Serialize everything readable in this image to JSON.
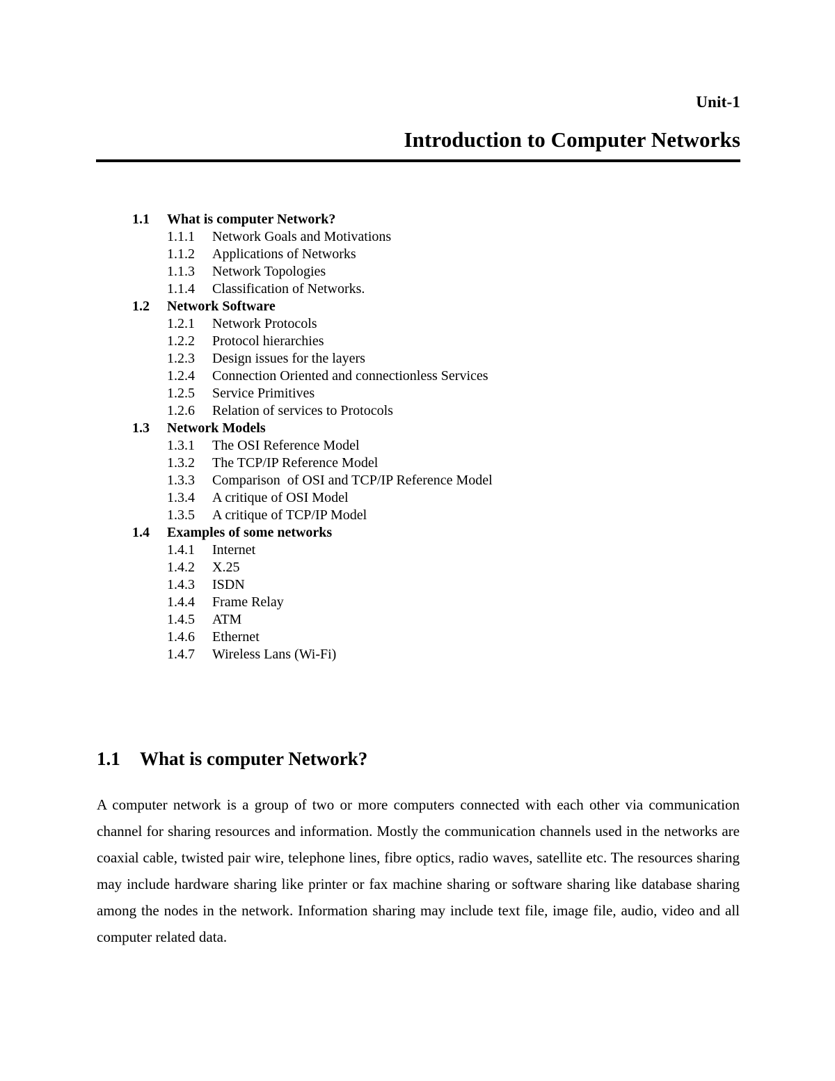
{
  "header": {
    "unit_label": "Unit-1",
    "doc_title": "Introduction to Computer Networks"
  },
  "toc": {
    "sections": [
      {
        "number": "1.1",
        "label": "What is computer Network?",
        "items": [
          {
            "number": "1.1.1",
            "label": "Network Goals and Motivations"
          },
          {
            "number": "1.1.2",
            "label": "Applications of Networks"
          },
          {
            "number": "1.1.3",
            "label": "Network Topologies"
          },
          {
            "number": "1.1.4",
            "label": "Classification of Networks."
          }
        ]
      },
      {
        "number": "1.2",
        "label": "Network Software",
        "items": [
          {
            "number": "1.2.1",
            "label": "Network Protocols"
          },
          {
            "number": "1.2.2",
            "label": "Protocol hierarchies"
          },
          {
            "number": "1.2.3",
            "label": "Design issues for the layers"
          },
          {
            "number": "1.2.4",
            "label": "Connection Oriented and connectionless Services"
          },
          {
            "number": "1.2.5",
            "label": "Service Primitives"
          },
          {
            "number": "1.2.6",
            "label": "Relation of services to Protocols"
          }
        ]
      },
      {
        "number": "1.3",
        "label": "Network Models",
        "items": [
          {
            "number": "1.3.1",
            "label": "The OSI Reference Model"
          },
          {
            "number": "1.3.2",
            "label": "The TCP/IP Reference Model"
          },
          {
            "number": "1.3.3",
            "label": "Comparison  of OSI and TCP/IP Reference Model"
          },
          {
            "number": "1.3.4",
            "label": "A critique of OSI Model"
          },
          {
            "number": "1.3.5",
            "label": "A critique of TCP/IP Model"
          }
        ]
      },
      {
        "number": "1.4",
        "label": "Examples of some networks",
        "items": [
          {
            "number": "1.4.1",
            "label": "Internet"
          },
          {
            "number": "1.4.2",
            "label": "X.25"
          },
          {
            "number": "1.4.3",
            "label": "ISDN"
          },
          {
            "number": "1.4.4",
            "label": "Frame Relay"
          },
          {
            "number": "1.4.5",
            "label": "ATM"
          },
          {
            "number": "1.4.6",
            "label": "Ethernet"
          },
          {
            "number": "1.4.7",
            "label": "Wireless Lans (Wi-Fi)"
          }
        ]
      }
    ]
  },
  "body": {
    "heading_number": "1.1",
    "heading_label": "What is computer Network?",
    "paragraph": "A computer network is a group of two or more computers connected with each other via communication channel for sharing resources and information. Mostly the communication channels used in the networks are coaxial cable, twisted pair wire, telephone lines, fibre optics, radio waves, satellite etc. The resources sharing may include hardware sharing like printer or fax machine sharing or software sharing like database sharing among the nodes in the network. Information sharing may include text file, image file, audio, video and all computer related data."
  },
  "colors": {
    "page_background": "#ffffff",
    "text": "#000000",
    "rule": "#000000"
  }
}
